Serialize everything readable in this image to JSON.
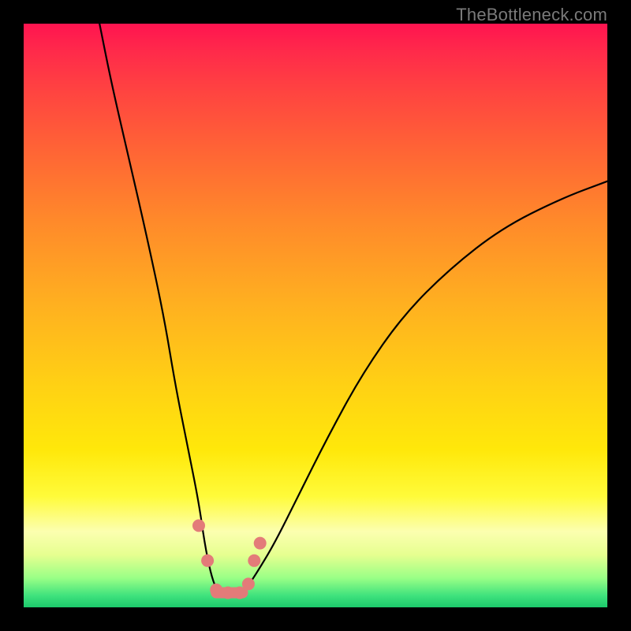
{
  "watermark": "TheBottleneck.com",
  "colors": {
    "frame_bg": "#000000",
    "curve_stroke": "#000000",
    "marker_fill": "#e37b79",
    "gradient_top": "#ff1450",
    "gradient_bottom": "#1cc96b"
  },
  "chart_data": {
    "type": "line",
    "title": "",
    "xlabel": "",
    "ylabel": "",
    "xlim": [
      0,
      100
    ],
    "ylim": [
      0,
      100
    ],
    "grid": false,
    "note": "No axis ticks or numeric labels are rendered; values are estimates read from pixel positions within the 0–100 normalized plot area. y is bottleneck % (0 at bottom, 100 at top).",
    "series": [
      {
        "name": "bottleneck-curve",
        "x": [
          13,
          15,
          18,
          21,
          24,
          26,
          28,
          30,
          31,
          32,
          33,
          34,
          36,
          38,
          40,
          43,
          47,
          52,
          58,
          65,
          73,
          82,
          92,
          100
        ],
        "y": [
          100,
          90,
          77,
          64,
          50,
          38,
          28,
          18,
          11,
          6,
          3,
          2,
          2,
          3,
          6,
          11,
          19,
          29,
          40,
          50,
          58,
          65,
          70,
          73
        ]
      }
    ],
    "markers": {
      "name": "highlighted-points",
      "x": [
        30.0,
        31.5,
        33.0,
        35.0,
        37.0,
        38.5,
        39.5,
        40.5
      ],
      "y": [
        14.0,
        8.0,
        3.0,
        2.5,
        2.5,
        4.0,
        8.0,
        11.0
      ]
    },
    "bottom_segment": {
      "name": "valley-segment",
      "x": [
        33.0,
        37.5
      ],
      "y": [
        2.5,
        2.5
      ]
    }
  }
}
